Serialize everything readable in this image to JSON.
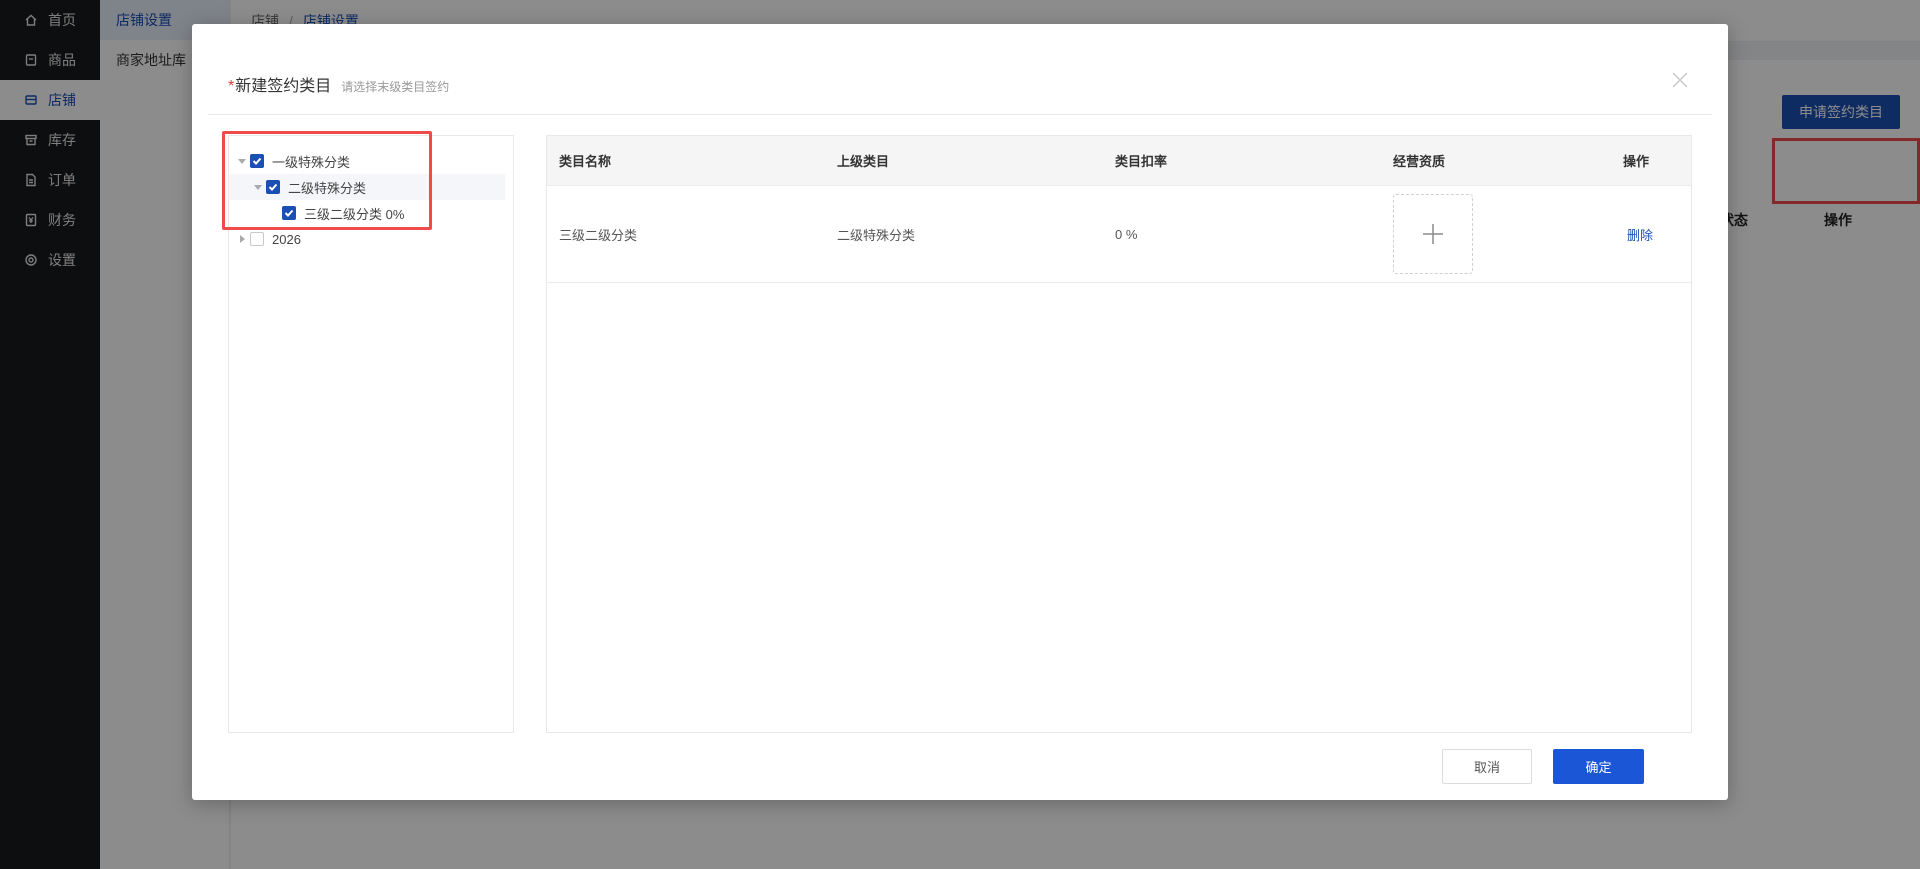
{
  "nav": {
    "items": [
      {
        "label": "首页",
        "icon": "home-icon"
      },
      {
        "label": "商品",
        "icon": "box-icon"
      },
      {
        "label": "店铺",
        "icon": "shop-icon"
      },
      {
        "label": "库存",
        "icon": "archive-icon"
      },
      {
        "label": "订单",
        "icon": "file-icon"
      },
      {
        "label": "财务",
        "icon": "finance-icon"
      },
      {
        "label": "设置",
        "icon": "gear-icon"
      }
    ],
    "active": "店铺"
  },
  "subnav": {
    "items": [
      {
        "label": "店铺设置"
      },
      {
        "label": "商家地址库"
      }
    ]
  },
  "breadcrumb": {
    "root": "店铺",
    "separator": "/",
    "current": "店铺设置"
  },
  "background": {
    "apply_button": "申请签约类目",
    "columns": {
      "status": "状态",
      "action": "操作"
    }
  },
  "modal": {
    "required_mark": "*",
    "title": "新建签约类目",
    "subtitle": "请选择末级类目签约",
    "tree": {
      "level1": {
        "label": "一级特殊分类",
        "checked": true,
        "expanded": true
      },
      "level2": {
        "label": "二级特殊分类",
        "checked": true,
        "expanded": true
      },
      "level3": {
        "label": "三级二级分类 0%",
        "checked": true
      },
      "other": {
        "label": "2026",
        "checked": false,
        "expanded": false
      }
    },
    "table": {
      "headers": {
        "name": "类目名称",
        "parent": "上级类目",
        "rate": "类目扣率",
        "qualification": "经营资质",
        "action": "操作"
      },
      "rows": [
        {
          "name": "三级二级分类",
          "parent": "二级特殊分类",
          "rate": "0 %",
          "action": "删除"
        }
      ]
    },
    "buttons": {
      "cancel": "取消",
      "confirm": "确定"
    }
  },
  "colors": {
    "primary": "#1a4fb3",
    "confirm": "#1a56d6",
    "highlight": "#ee4b4b",
    "nav_bg": "#191a1c"
  }
}
